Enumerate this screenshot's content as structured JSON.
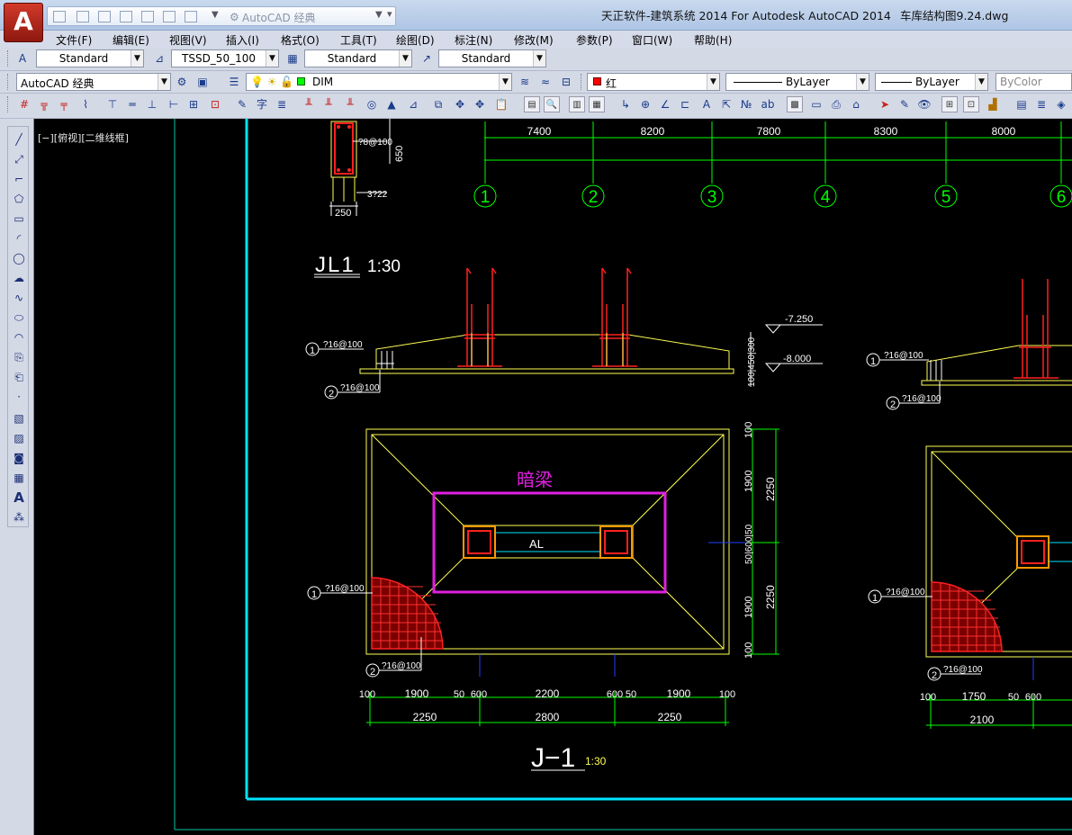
{
  "titlebar": {
    "logo_letter": "A",
    "workspace": "AutoCAD 经典",
    "title": "天正软件-建筑系统 2014  For Autodesk AutoCAD 2014",
    "filename": "车库结构图9.24.dwg"
  },
  "menu": [
    "文件(F)",
    "编辑(E)",
    "视图(V)",
    "插入(I)",
    "格式(O)",
    "工具(T)",
    "绘图(D)",
    "标注(N)",
    "修改(M)",
    "参数(P)",
    "窗口(W)",
    "帮助(H)"
  ],
  "toolbar1": {
    "text_style": "Standard",
    "dim_style": "TSSD_50_100",
    "table_style": "Standard",
    "multileader_style": "Standard"
  },
  "toolbar2": {
    "workspace": "AutoCAD 经典",
    "layer": "DIM",
    "color": "红",
    "linetype": "ByLayer",
    "lineweight": "ByLayer",
    "plotstyle": "ByColor"
  },
  "viewport_label": "[−][俯视][二维线框]",
  "drawing": {
    "axis_spacing": [
      "7400",
      "8200",
      "7800",
      "8300",
      "8000"
    ],
    "axis_numbers": [
      "1",
      "2",
      "3",
      "4",
      "5",
      "6"
    ],
    "col_detail": {
      "stirrup": "?8@100",
      "height": "650",
      "bottom_bars": "3?22",
      "width": "250"
    },
    "section_title": "JL1",
    "section_scale": "1:30",
    "elev_top": "-7.250",
    "elev_bottom": "-8.000",
    "section_dims_vertical": "100|450|300",
    "rebar_1": "?16@100",
    "rebar_2": "?16@100",
    "callout_1": "1",
    "callout_2": "2",
    "dark_beam_label": "暗梁",
    "beam_label": "AL",
    "plan_dims_right_small": [
      "100",
      "1900",
      "50|600|50",
      "1900",
      "100"
    ],
    "plan_dims_right_large": [
      "2250",
      "2250"
    ],
    "plan_dims_bottom_small": [
      "100",
      "1900",
      "50",
      "600",
      "2200",
      "600",
      "50",
      "1900",
      "100"
    ],
    "plan_dims_bottom_large": [
      "2250",
      "2800",
      "2250"
    ],
    "plan_title": "J−1",
    "plan_scale": "1:30",
    "plan2_dims_bottom": [
      "100",
      "1750",
      "50",
      "600"
    ],
    "plan2_dims_large": [
      "2100"
    ]
  }
}
